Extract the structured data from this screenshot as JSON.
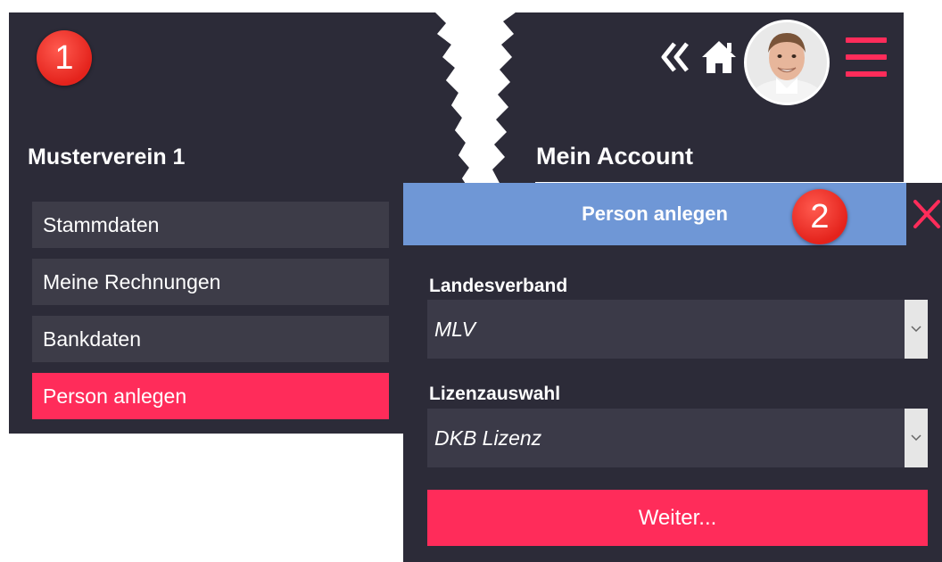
{
  "annotations": {
    "step1": "1",
    "step2": "2"
  },
  "left": {
    "club_title": "Musterverein 1",
    "menu": [
      {
        "label": "Stammdaten",
        "active": false
      },
      {
        "label": "Meine Rechnungen",
        "active": false
      },
      {
        "label": "Bankdaten",
        "active": false
      },
      {
        "label": "Person anlegen",
        "active": true
      }
    ]
  },
  "right": {
    "account_title": "Mein Account",
    "icons": [
      "double-chevron-left-icon",
      "home-icon",
      "avatar",
      "hamburger-menu-icon"
    ]
  },
  "dialog": {
    "title": "Person anlegen",
    "fields": [
      {
        "label": "Landesverband",
        "value": "MLV"
      },
      {
        "label": "Lizenzauswahl",
        "value": "DKB Lizenz"
      }
    ],
    "submit_label": "Weiter..."
  },
  "colors": {
    "panel_bg": "#2c2b38",
    "accent": "#ff2c5a",
    "header_blue": "#6f97d6",
    "menu_item_bg": "#3d3c48",
    "badge_red": "#e4231c"
  }
}
